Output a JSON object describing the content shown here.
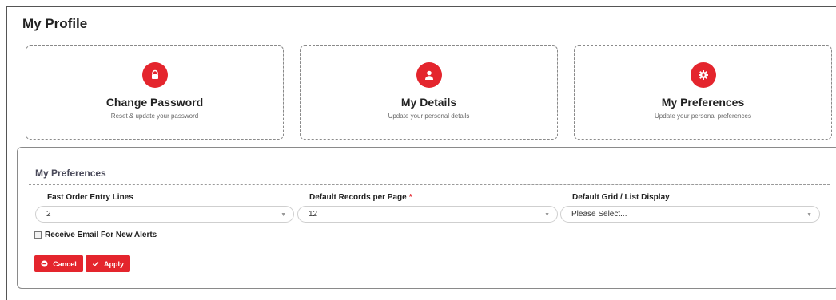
{
  "page": {
    "title": "My Profile"
  },
  "cards": [
    {
      "title": "Change Password",
      "subtitle": "Reset & update your password",
      "icon": "lock-icon"
    },
    {
      "title": "My Details",
      "subtitle": "Update your personal details",
      "icon": "user-icon"
    },
    {
      "title": "My Preferences",
      "subtitle": "Update your personal preferences",
      "icon": "gear-icon"
    }
  ],
  "preferences": {
    "title": "My Preferences",
    "fields": [
      {
        "label": "Fast Order Entry Lines",
        "value": "2",
        "required": false
      },
      {
        "label": "Default Records per Page",
        "value": "12",
        "required": true,
        "required_mark": "*"
      },
      {
        "label": "Default Grid / List Display",
        "value": "Please Select...",
        "required": false
      }
    ],
    "checkbox": {
      "label": "Receive Email For New Alerts",
      "checked": false
    },
    "buttons": {
      "cancel": "Cancel",
      "apply": "Apply"
    }
  },
  "colors": {
    "accent": "#e4252d",
    "text": "#222222",
    "muted": "#666666"
  }
}
